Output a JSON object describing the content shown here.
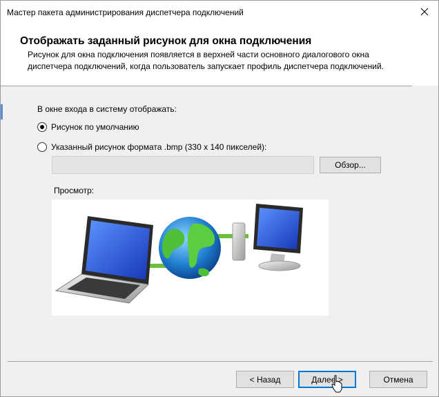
{
  "window": {
    "title": "Мастер пакета администрирования диспетчера подключений",
    "close_icon": "close-icon"
  },
  "header": {
    "title": "Отображать заданный рисунок для окна подключения",
    "description": "Рисунок для окна подключения появляется в верхней части основного диалогового окна диспетчера подключений, когда пользователь запускает профиль диспетчера подключений."
  },
  "body": {
    "section_label": "В окне входа в систему отображать:",
    "options": [
      {
        "label": "Рисунок по умолчанию",
        "checked": true
      },
      {
        "label": "Указанный рисунок формата .bmp (330 x 140 пикселей):",
        "checked": false
      }
    ],
    "path_value": "",
    "browse_label": "Обзор...",
    "preview_label": "Просмотр:"
  },
  "footer": {
    "back_label": "< Назад",
    "next_label": "Далее >",
    "cancel_label": "Отмена"
  },
  "colors": {
    "accent": "#0078d7",
    "connector_green": "#6bbf3a",
    "screen_blue": "#1f4fd8"
  }
}
